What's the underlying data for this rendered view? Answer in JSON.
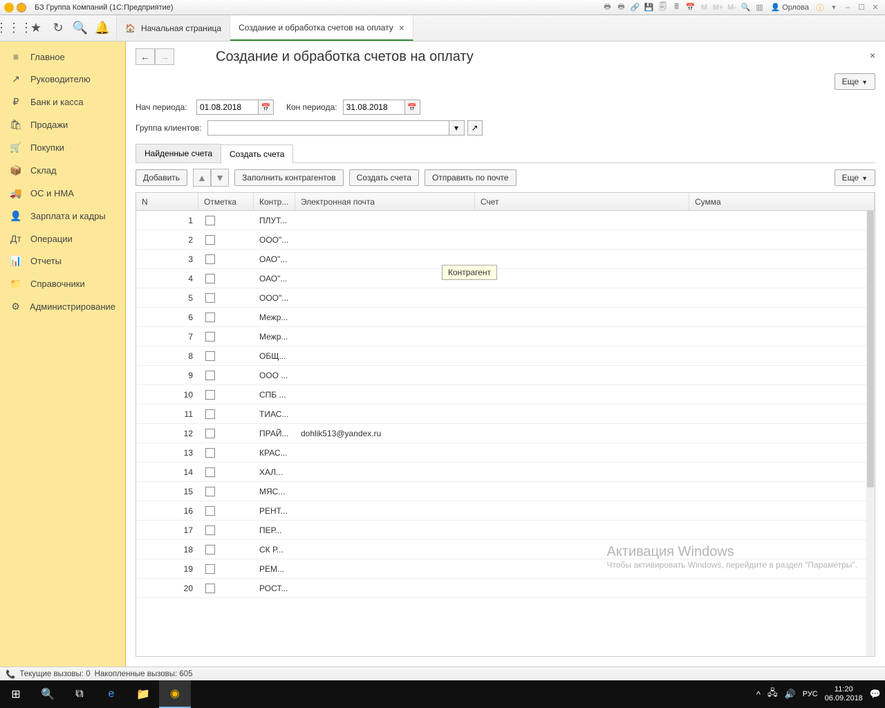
{
  "title": "БЗ Группа Компаний  (1С:Предприятие)",
  "user": "Орлова",
  "topTabs": {
    "home": "Начальная страница",
    "active": "Создание и обработка счетов на оплату"
  },
  "sidebar": [
    {
      "icon": "≡",
      "label": "Главное"
    },
    {
      "icon": "↗",
      "label": "Руководителю"
    },
    {
      "icon": "₽",
      "label": "Банк и касса"
    },
    {
      "icon": "🛍",
      "label": "Продажи"
    },
    {
      "icon": "🛒",
      "label": "Покупки"
    },
    {
      "icon": "📦",
      "label": "Склад"
    },
    {
      "icon": "🚚",
      "label": "ОС и НМА"
    },
    {
      "icon": "👤",
      "label": "Зарплата и кадры"
    },
    {
      "icon": "Дт",
      "label": "Операции"
    },
    {
      "icon": "📊",
      "label": "Отчеты"
    },
    {
      "icon": "📁",
      "label": "Справочники"
    },
    {
      "icon": "⚙",
      "label": "Администрирование"
    }
  ],
  "page": {
    "title": "Создание и обработка счетов на оплату",
    "moreBtn": "Еще",
    "startLabel": "Нач периода:",
    "startDate": "01.08.2018",
    "endLabel": "Кон периода:",
    "endDate": "31.08.2018",
    "groupLabel": "Группа клиентов:",
    "groupValue": ""
  },
  "subtabs": {
    "found": "Найденные счета",
    "create": "Создать счета"
  },
  "actions": {
    "add": "Добавить",
    "fill": "Заполнить контрагентов",
    "create": "Создать счета",
    "send": "Отправить по почте",
    "more": "Еще"
  },
  "columns": {
    "n": "N",
    "mark": "Отметка",
    "contr": "Контр...",
    "email": "Электронная почта",
    "bill": "Счет",
    "sum": "Сумма"
  },
  "tooltip": "Контрагент",
  "rows": [
    {
      "n": 1,
      "contr": "ПЛУТ...",
      "email": ""
    },
    {
      "n": 2,
      "contr": "ООО\"...",
      "email": ""
    },
    {
      "n": 3,
      "contr": "ОАО\"...",
      "email": ""
    },
    {
      "n": 4,
      "contr": "ОАО\"...",
      "email": ""
    },
    {
      "n": 5,
      "contr": "ООО\"...",
      "email": ""
    },
    {
      "n": 6,
      "contr": "Межр...",
      "email": ""
    },
    {
      "n": 7,
      "contr": "Межр...",
      "email": ""
    },
    {
      "n": 8,
      "contr": "ОБЩ...",
      "email": ""
    },
    {
      "n": 9,
      "contr": "ООО ...",
      "email": ""
    },
    {
      "n": 10,
      "contr": "СПБ ...",
      "email": ""
    },
    {
      "n": 11,
      "contr": "ТИАС...",
      "email": ""
    },
    {
      "n": 12,
      "contr": "ПРАЙ...",
      "email": "dohlik513@yandex.ru"
    },
    {
      "n": 13,
      "contr": "КРАС...",
      "email": ""
    },
    {
      "n": 14,
      "contr": "ХАЛ...",
      "email": ""
    },
    {
      "n": 15,
      "contr": "МЯС...",
      "email": ""
    },
    {
      "n": 16,
      "contr": "РЕНТ...",
      "email": ""
    },
    {
      "n": 17,
      "contr": "ПЕР...",
      "email": ""
    },
    {
      "n": 18,
      "contr": "СК Р...",
      "email": ""
    },
    {
      "n": 19,
      "contr": "РЕМ...",
      "email": ""
    },
    {
      "n": 20,
      "contr": "РОСТ...",
      "email": ""
    }
  ],
  "watermark": {
    "line1": "Активация Windows",
    "line2": "Чтобы активировать Windows, перейдите в раздел \"Параметры\"."
  },
  "appStatus": {
    "current": "Текущие вызовы: 0",
    "accum": "Накопленные вызовы: 605"
  },
  "taskbar": {
    "lang": "РУС",
    "time": "11:20",
    "date": "06.09.2018"
  }
}
